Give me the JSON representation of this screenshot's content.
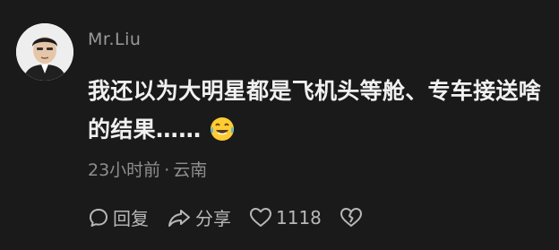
{
  "comment": {
    "username": "Mr.Liu",
    "line1": "我还以为大明星都是飞机头等舱、专车接送啥",
    "line2": "的结果……",
    "emoji": "laughing-tears-icon",
    "time": "23小时前",
    "separator": "·",
    "location": "云南",
    "actions": {
      "reply_label": "回复",
      "share_label": "分享",
      "like_count": "1118"
    }
  }
}
